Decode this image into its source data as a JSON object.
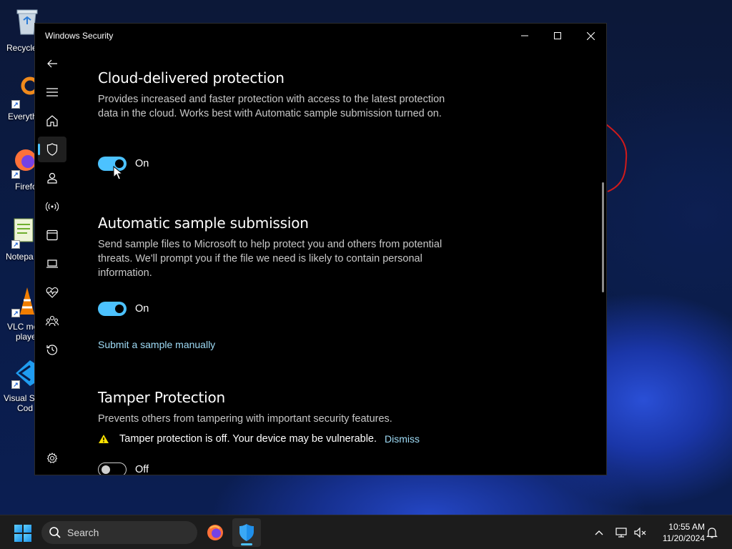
{
  "desktop": {
    "icons": [
      {
        "name": "recycle-bin",
        "label": "Recycle"
      },
      {
        "name": "everything",
        "label": "Everyth"
      },
      {
        "name": "firefox",
        "label": "Firefo"
      },
      {
        "name": "notepad",
        "label": "Notepa"
      },
      {
        "name": "vlc",
        "label1": "VLC me",
        "label2": "playe"
      },
      {
        "name": "vscode",
        "label1": "Visual St",
        "label2": "Cod"
      }
    ]
  },
  "window": {
    "title": "Windows Security",
    "controls": {
      "minimize_icon": "minimize-icon",
      "maximize_icon": "maximize-icon",
      "close_icon": "close-icon"
    }
  },
  "nav": {
    "items": [
      {
        "icon": "back-arrow-icon"
      },
      {
        "icon": "hamburger-menu-icon"
      },
      {
        "icon": "home-icon"
      },
      {
        "icon": "shield-icon",
        "active": true
      },
      {
        "icon": "account-icon"
      },
      {
        "icon": "network-icon"
      },
      {
        "icon": "app-browser-icon"
      },
      {
        "icon": "device-laptop-icon"
      },
      {
        "icon": "health-icon"
      },
      {
        "icon": "family-icon"
      },
      {
        "icon": "history-icon"
      },
      {
        "icon": "settings-gear-icon"
      }
    ]
  },
  "sections": {
    "cloud": {
      "title": "Cloud-delivered protection",
      "description": "Provides increased and faster protection with access to the latest protection data in the cloud. Works best with Automatic sample submission turned on.",
      "toggle_state": "On"
    },
    "sample": {
      "title": "Automatic sample submission",
      "description": "Send sample files to Microsoft to help protect you and others from potential threats. We'll prompt you if the file we need is likely to contain personal information.",
      "toggle_state": "On",
      "link": "Submit a sample manually"
    },
    "tamper": {
      "title": "Tamper Protection",
      "description": "Prevents others from tampering with important security features.",
      "warning": "Tamper protection is off. Your device may be vulnerable.",
      "dismiss": "Dismiss",
      "toggle_state": "Off"
    }
  },
  "taskbar": {
    "search_placeholder": "Search",
    "apps": [
      "firefox",
      "windows-security"
    ],
    "time": "10:55 AM",
    "date": "11/20/2024"
  },
  "colors": {
    "accent": "#4cc2ff",
    "link": "#9fdcf7",
    "warning": "#fce100"
  }
}
